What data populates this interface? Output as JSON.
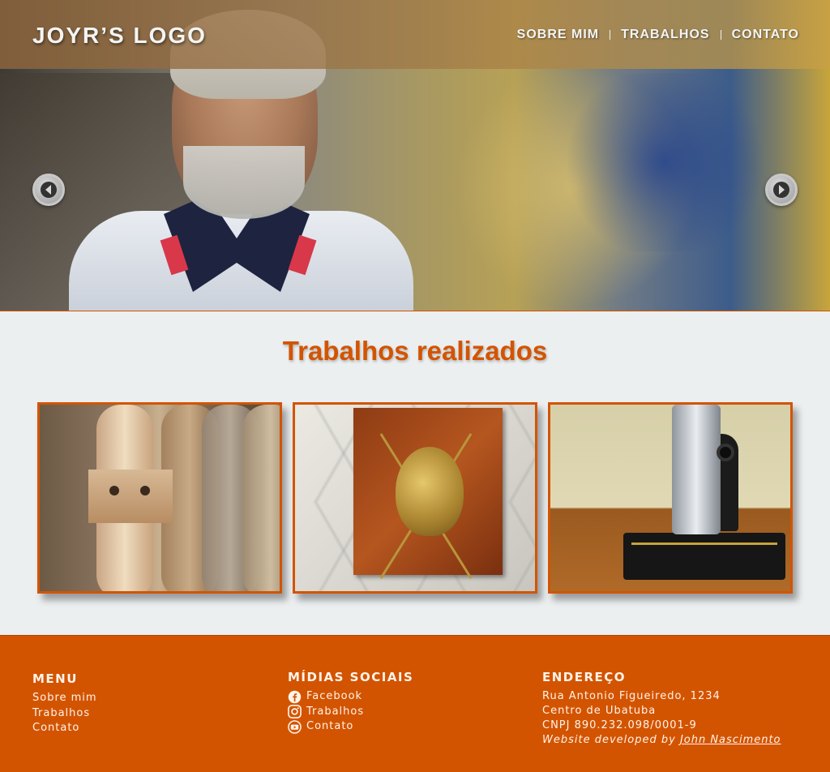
{
  "header": {
    "logo": "JOYR’S LOGO",
    "nav": [
      {
        "label": "SOBRE MIM"
      },
      {
        "label": "TRABALHOS"
      },
      {
        "label": "CONTATO"
      }
    ]
  },
  "hero": {
    "prev_icon": "arrow-left-circle-icon",
    "next_icon": "arrow-right-circle-icon"
  },
  "works": {
    "title": "Trabalhos realizados",
    "items": [
      {
        "icon": "wooden-furniture-legs-photo"
      },
      {
        "icon": "heraldic-plaque-photo"
      },
      {
        "icon": "sewing-machine-photo"
      }
    ]
  },
  "footer": {
    "menu": {
      "title": "MENU",
      "items": [
        "Sobre mim",
        "Trabalhos",
        "Contato"
      ]
    },
    "social": {
      "title": "MÍDIAS SOCIAIS",
      "items": [
        {
          "label": "Facebook",
          "icon": "facebook-icon"
        },
        {
          "label": "Trabalhos",
          "icon": "instagram-icon"
        },
        {
          "label": "Contato",
          "icon": "youtube-icon"
        }
      ]
    },
    "address": {
      "title": "ENDEREÇO",
      "lines": [
        "Rua Antonio Figueiredo, 1234",
        "Centro de Ubatuba",
        "CNPJ 890.232.098/0001-9"
      ],
      "credit_prefix": "Website developed by ",
      "credit_name": "John Nascimento"
    }
  },
  "colors": {
    "accent": "#d35400",
    "background": "#eceff0",
    "footer_text": "#fff4ea"
  }
}
